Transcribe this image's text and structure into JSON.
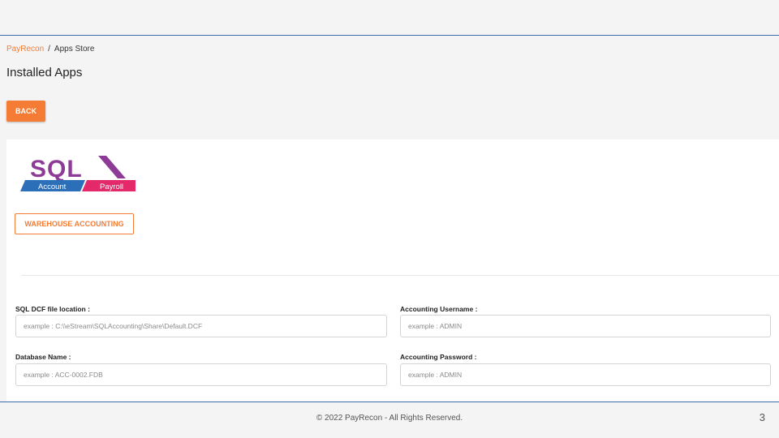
{
  "breadcrumb": {
    "root": "PayRecon",
    "separator": "/",
    "current": "Apps Store"
  },
  "page": {
    "title": "Installed Apps",
    "back_label": "BACK"
  },
  "app": {
    "logo_text": "SQL",
    "logo_tag_left": "Account",
    "logo_tag_right": "Payroll",
    "category_label": "WAREHOUSE ACCOUNTING"
  },
  "form": {
    "dcf_location": {
      "label": "SQL DCF file location :",
      "placeholder": "example : C:\\\\eStream\\SQLAccounting\\Share\\Default.DCF",
      "value": ""
    },
    "acc_username": {
      "label": "Accounting Username :",
      "placeholder": "example : ADMIN",
      "value": ""
    },
    "db_name": {
      "label": "Database Name :",
      "placeholder": "example : ACC-0002.FDB",
      "value": ""
    },
    "acc_password": {
      "label": "Accounting Password :",
      "placeholder": "example : ADMIN",
      "value": ""
    }
  },
  "footer": {
    "copyright": "© 2022 PayRecon - All Rights Reserved.",
    "page_number": "3"
  },
  "colors": {
    "accent": "#f57c34",
    "rule": "#3d6aa8",
    "logo_purple": "#8e3b97",
    "logo_blue": "#2a6fb8",
    "logo_pink": "#e3296a"
  }
}
